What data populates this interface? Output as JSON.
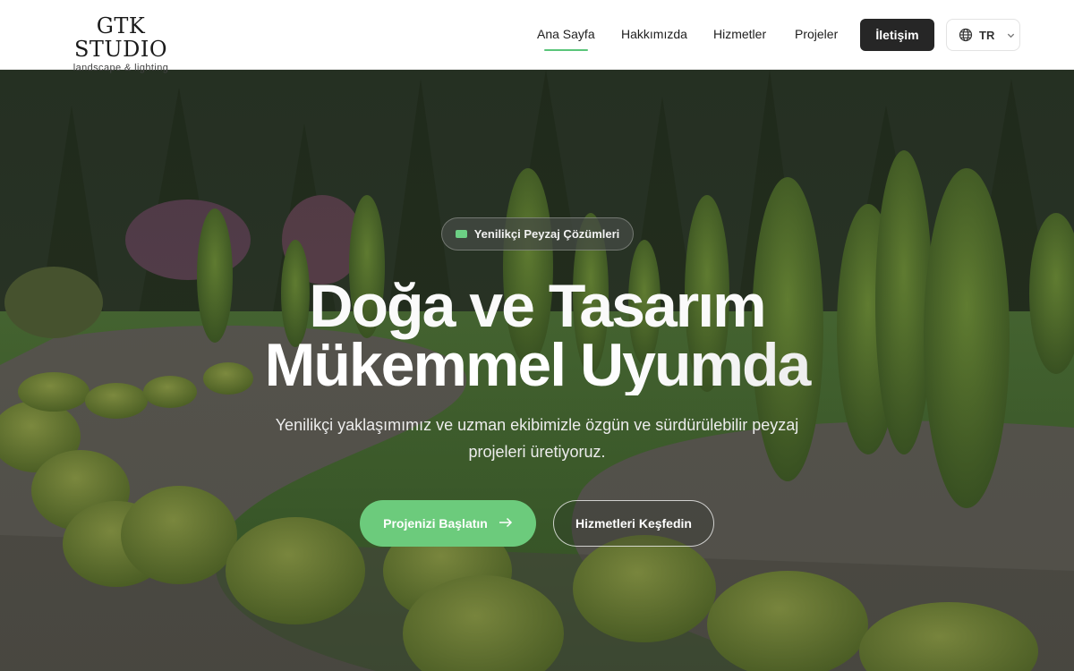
{
  "brand": {
    "title": "GTK STUDIO",
    "subtitle": "landscape & lighting"
  },
  "nav": {
    "items": [
      {
        "label": "Ana Sayfa",
        "active": true
      },
      {
        "label": "Hakkımızda",
        "active": false
      },
      {
        "label": "Hizmetler",
        "active": false
      },
      {
        "label": "Projeler",
        "active": false
      }
    ],
    "cta_label": "İletişim",
    "language": {
      "code": "TR",
      "icon": "globe-icon",
      "chevron": "chevron-down-icon"
    }
  },
  "hero": {
    "badge": "Yenilikçi Peyzaj Çözümleri",
    "headline_line1": "Doğa ve Tasarım",
    "headline_line2": "Mükemmel Uyumda",
    "subtext": "Yenilikçi yaklaşımımız ve uzman ekibimizle özgün ve sürdürülebilir peyzaj projeleri üretiyoruz.",
    "primary_button": "Projenizi Başlatın",
    "secondary_button": "Hizmetleri Keşfedin"
  },
  "colors": {
    "accent_green": "#6ccb7c",
    "dark_button": "#262626"
  }
}
